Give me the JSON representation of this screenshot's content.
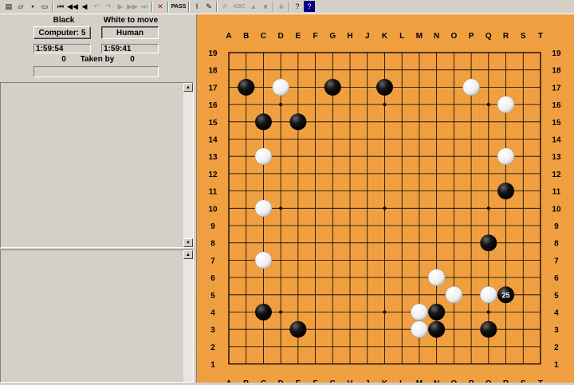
{
  "toolbar": {
    "icons": [
      "new-game-icon",
      "open-file-icon",
      "save-file-icon",
      "print-icon",
      "first-move-icon",
      "back-ten-icon",
      "back-one-icon",
      "undo-icon",
      "redo-icon",
      "forward-one-icon",
      "forward-ten-icon",
      "last-move-icon",
      "delete-move-icon",
      "pass-icon",
      "edit-icon",
      "setup-icon",
      "grid-icon",
      "abc-icon",
      "triangle-icon",
      "square-icon",
      "circle-icon",
      "help-icon",
      "context-help-icon"
    ],
    "pass_label": "PASS",
    "abc_label": "ABC"
  },
  "players": {
    "black_label": "Black",
    "white_label": "White to move",
    "black_player": "Computer: 5",
    "white_player": "Human",
    "black_time": "1:59:54",
    "white_time": "1:59:41",
    "black_captured": "0",
    "taken_by_label": "Taken by",
    "white_captured": "0"
  },
  "board": {
    "size": 19,
    "columns": [
      "A",
      "B",
      "C",
      "D",
      "E",
      "F",
      "G",
      "H",
      "J",
      "K",
      "L",
      "M",
      "N",
      "O",
      "P",
      "Q",
      "R",
      "S",
      "T"
    ],
    "rows": [
      "19",
      "18",
      "17",
      "16",
      "15",
      "14",
      "13",
      "12",
      "11",
      "10",
      "9",
      "8",
      "7",
      "6",
      "5",
      "4",
      "3",
      "2",
      "1"
    ],
    "star_points": [
      "D16",
      "K16",
      "Q16",
      "D10",
      "K10",
      "Q10",
      "D4",
      "K4",
      "Q4"
    ],
    "black_stones": [
      "B17",
      "G17",
      "K17",
      "C15",
      "E15",
      "R11",
      "Q8",
      "R5",
      "C4",
      "N4",
      "E3",
      "N3",
      "Q3"
    ],
    "white_stones": [
      "D17",
      "P17",
      "R16",
      "C13",
      "R13",
      "C10",
      "C7",
      "N6",
      "O5",
      "Q5",
      "M4",
      "M3"
    ],
    "last_move": {
      "point": "R5",
      "number": "25"
    }
  }
}
